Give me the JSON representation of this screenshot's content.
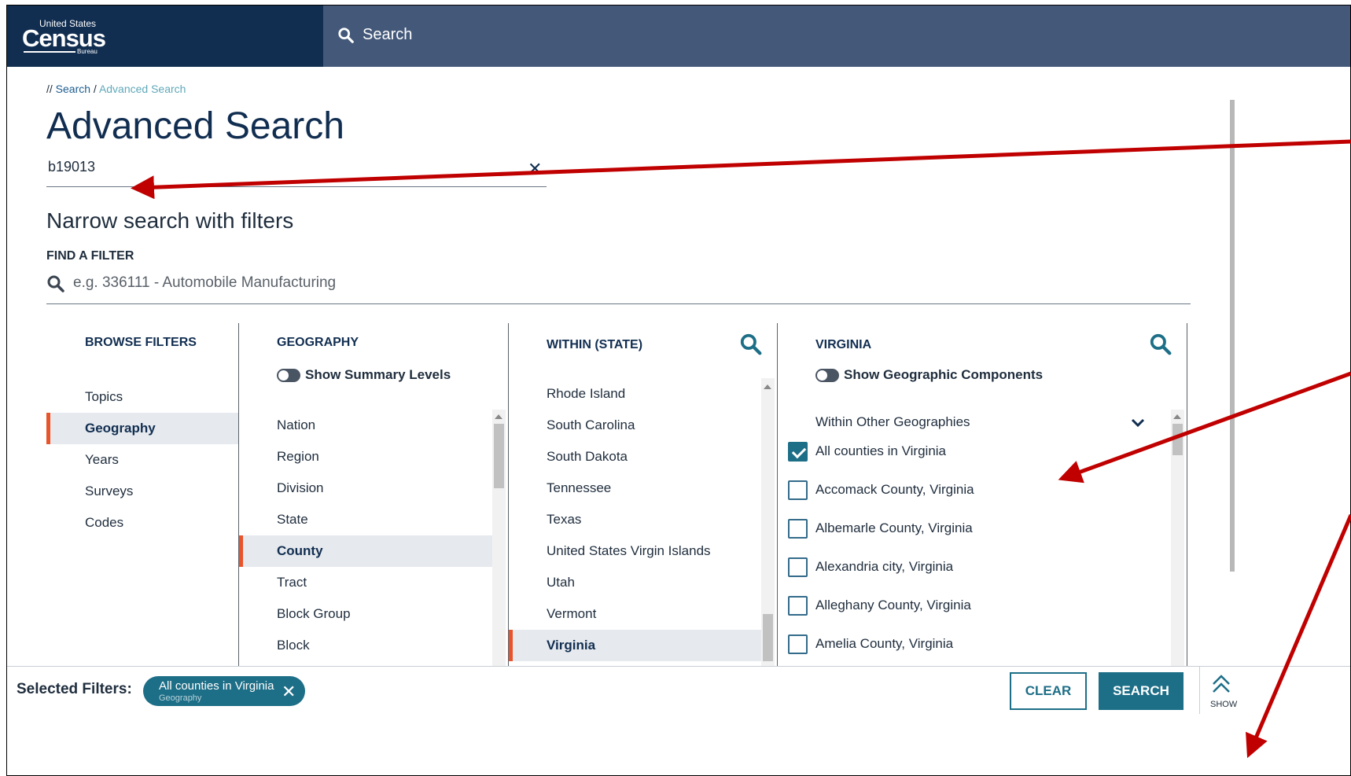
{
  "header": {
    "logo": {
      "line1": "United States",
      "line2": "Census",
      "line3": "Bureau"
    },
    "search_label": "Search"
  },
  "breadcrumb": {
    "prefix": "//",
    "link": "Search",
    "separator": "/",
    "current": "Advanced Search"
  },
  "page_title": "Advanced Search",
  "query": {
    "value": "b19013"
  },
  "filters": {
    "heading": "Narrow search with filters",
    "find_label": "FIND A FILTER",
    "find_placeholder": "e.g. 336111 - Automobile Manufacturing"
  },
  "browse": {
    "heading": "BROWSE FILTERS",
    "items": [
      "Topics",
      "Geography",
      "Years",
      "Surveys",
      "Codes"
    ],
    "selected": "Geography"
  },
  "geography": {
    "heading": "GEOGRAPHY",
    "toggle_label": "Show Summary Levels",
    "items": [
      "Nation",
      "Region",
      "Division",
      "State",
      "County",
      "Tract",
      "Block Group",
      "Block"
    ],
    "selected": "County"
  },
  "within_state": {
    "heading": "WITHIN (STATE)",
    "items": [
      "Rhode Island",
      "South Carolina",
      "South Dakota",
      "Tennessee",
      "Texas",
      "United States Virgin Islands",
      "Utah",
      "Vermont",
      "Virginia"
    ],
    "selected": "Virginia"
  },
  "virginia": {
    "heading": "VIRGINIA",
    "toggle_label": "Show Geographic Components",
    "section_label": "Within Other Geographies",
    "options": [
      {
        "label": "All counties in Virginia",
        "checked": true
      },
      {
        "label": "Accomack County, Virginia",
        "checked": false
      },
      {
        "label": "Albemarle County, Virginia",
        "checked": false
      },
      {
        "label": "Alexandria city, Virginia",
        "checked": false
      },
      {
        "label": "Alleghany County, Virginia",
        "checked": false
      },
      {
        "label": "Amelia County, Virginia",
        "checked": false
      }
    ]
  },
  "bottom_bar": {
    "selected_label": "Selected Filters:",
    "chip": {
      "label": "All counties in Virginia",
      "sublabel": "Geography"
    },
    "clear_label": "CLEAR",
    "search_label": "SEARCH",
    "show_label": "SHOW"
  },
  "colors": {
    "header_bg": "#44597a",
    "logo_bg": "#112e51",
    "accent": "#1d6e87",
    "selection_marker": "#e9542b",
    "annotation_arrow": "#c00000"
  }
}
